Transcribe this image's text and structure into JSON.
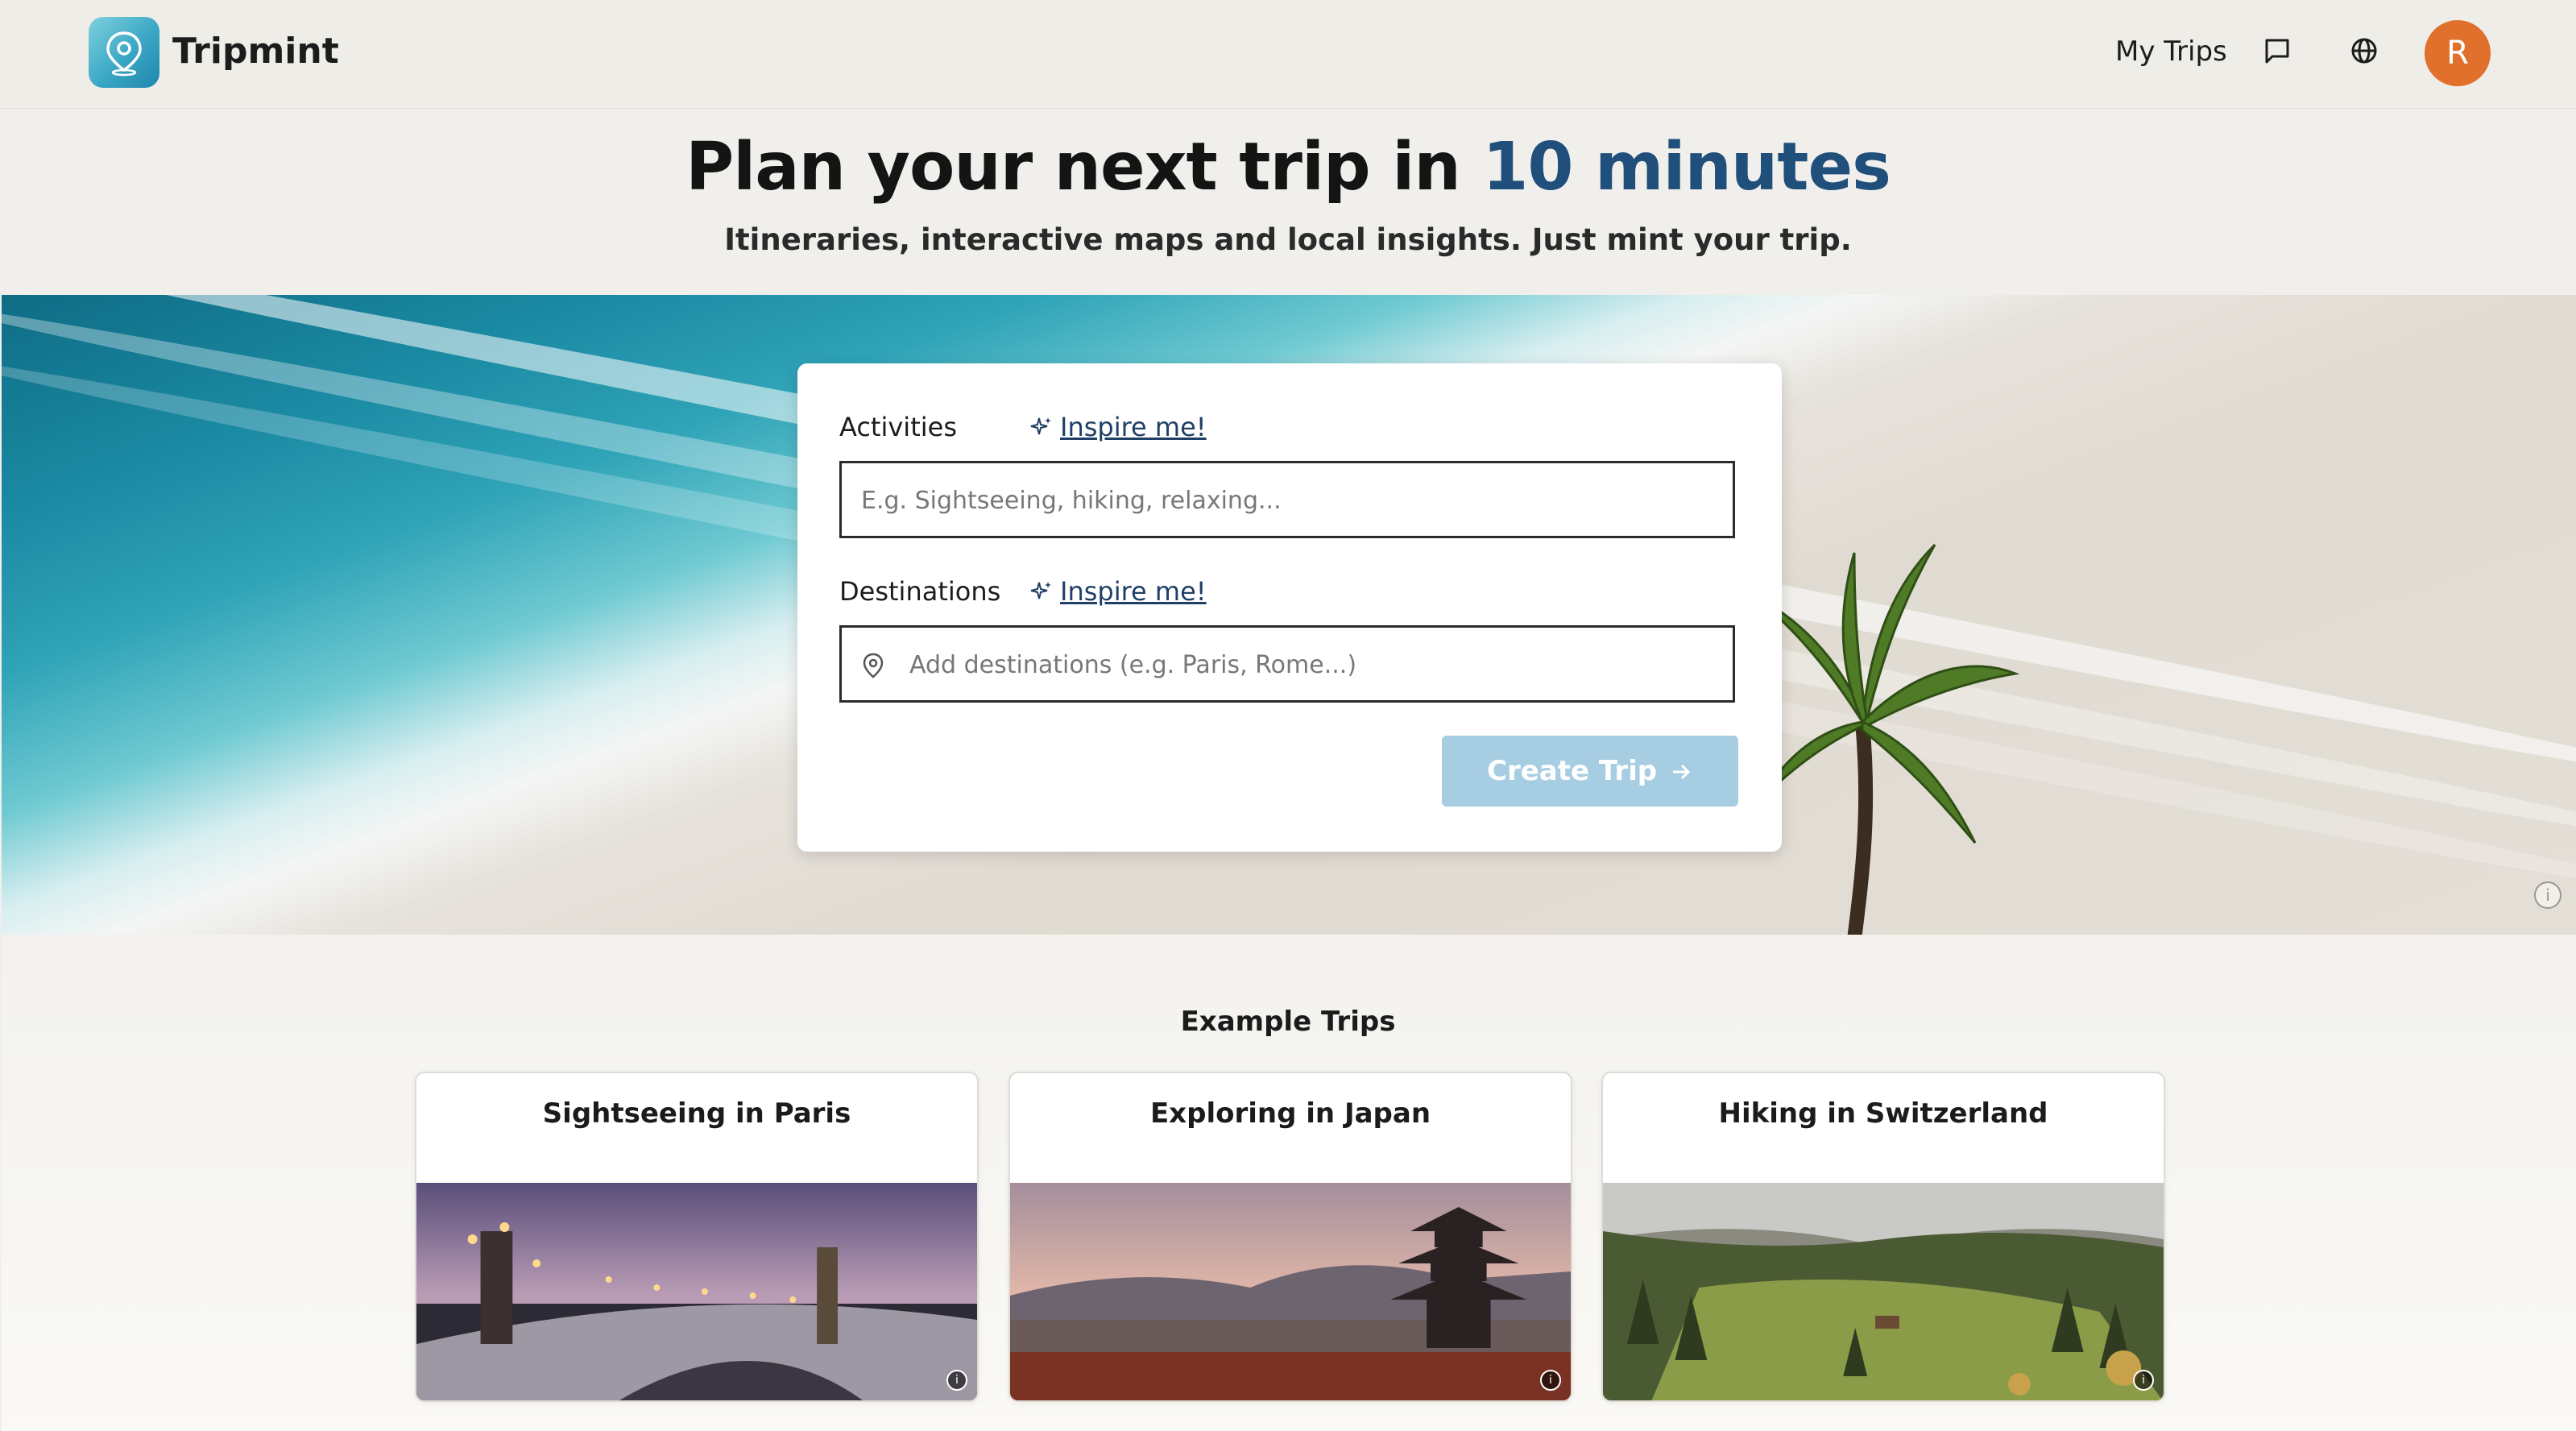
{
  "header": {
    "brand": "Tripmint",
    "nav_my_trips": "My Trips",
    "icons": [
      "logo-pin-icon",
      "chat-icon",
      "globe-icon"
    ],
    "avatar_initial": "R",
    "avatar_color": "#e0702c"
  },
  "hero": {
    "title_prefix": "Plan your next trip in ",
    "title_accent": "10 minutes",
    "accent_color": "#1f4f7a",
    "subtitle": "Itineraries, interactive maps and local insights. Just mint your trip."
  },
  "form": {
    "activities_label": "Activities",
    "activities_inspire": "Inspire me!",
    "activities_placeholder": "E.g. Sightseeing, hiking, relaxing...",
    "destinations_label": "Destinations",
    "destinations_inspire": "Inspire me!",
    "destinations_placeholder": "Add destinations (e.g. Paris, Rome...)",
    "create_button": "Create Trip"
  },
  "examples": {
    "title": "Example Trips",
    "trips": [
      {
        "title": "Sightseeing in Paris"
      },
      {
        "title": "Exploring in Japan"
      },
      {
        "title": "Hiking in Switzerland"
      }
    ]
  }
}
